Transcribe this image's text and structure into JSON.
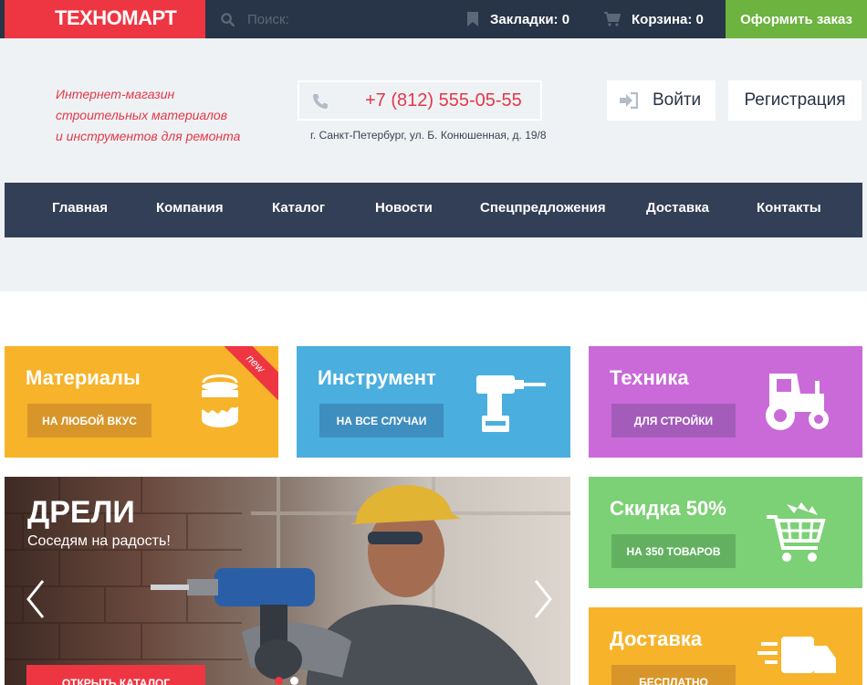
{
  "topbar": {
    "logo": "ТЕХНОМАРТ",
    "search_placeholder": "Поиск:",
    "bookmarks": "Закладки: 0",
    "cart": "Корзина: 0",
    "order_button": "Оформить заказ"
  },
  "header": {
    "tagline": [
      "Интернет-магазин",
      "строительных материалов",
      "и инструментов для ремонта"
    ],
    "phone": "+7 (812) 555-05-55",
    "address": "г. Санкт-Петербург, ул. Б. Конюшенная, д. 19/8",
    "login": "Войти",
    "register": "Регистрация"
  },
  "nav": {
    "items": [
      {
        "label": "Главная"
      },
      {
        "label": "Компания"
      },
      {
        "label": "Каталог"
      },
      {
        "label": "Новости"
      },
      {
        "label": "Спецпредложения"
      },
      {
        "label": "Доставка"
      },
      {
        "label": "Контакты"
      }
    ]
  },
  "tiles": {
    "materials": {
      "title": "Материалы",
      "button": "НА ЛЮБОЙ ВКУС",
      "ribbon": "new",
      "icon": "paint-bucket-icon"
    },
    "tools": {
      "title": "Инструмент",
      "button": "НА ВСЕ СЛУЧАИ",
      "icon": "drill-icon"
    },
    "tech": {
      "title": "Техника",
      "button": "ДЛЯ СТРОЙКИ",
      "icon": "tractor-icon"
    },
    "sale": {
      "title": "Скидка 50%",
      "button": "НА 350 ТОВАРОВ",
      "icon": "cart-icon"
    },
    "delivery": {
      "title": "Доставка",
      "button": "БЕСПЛАТНО",
      "icon": "truck-icon"
    }
  },
  "slider": {
    "title": "ДРЕЛИ",
    "subtitle": "Соседям на радость!",
    "button": "ОТКРЫТЬ КАТАЛОГ",
    "slides": 2,
    "active_slide": 1
  },
  "colors": {
    "topbar": "#283447",
    "accent_red": "#ee3643",
    "green": "#6cb33f",
    "nav": "#333f57",
    "orange": "#f7b32a",
    "blue": "#4aaedf",
    "purple": "#c96ad8",
    "light_green": "#7cd075"
  }
}
